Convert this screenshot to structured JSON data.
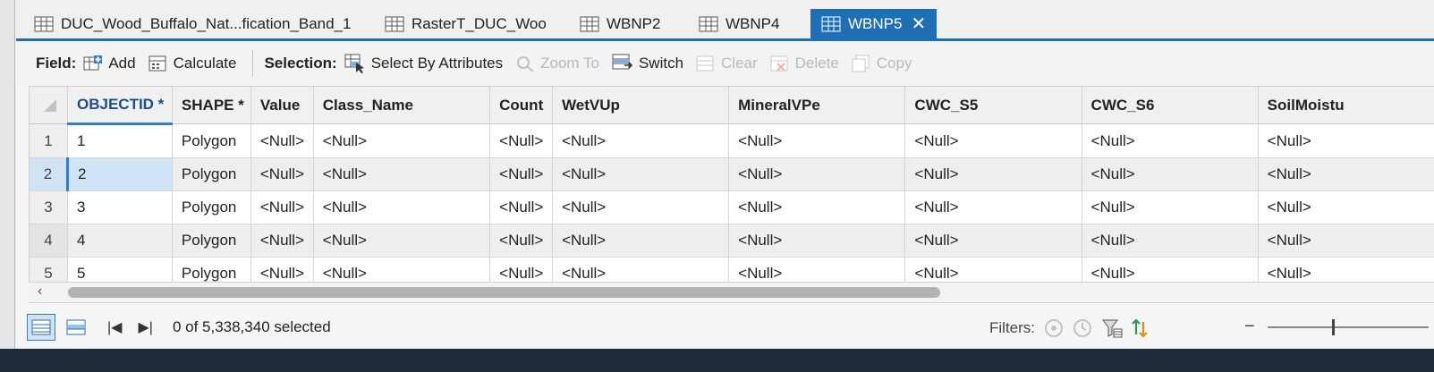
{
  "tabs": [
    {
      "label": "DUC_Wood_Buffalo_Nat...fication_Band_1",
      "active": false
    },
    {
      "label": "RasterT_DUC_Woo",
      "active": false
    },
    {
      "label": "WBNP2",
      "active": false
    },
    {
      "label": "WBNP4",
      "active": false
    },
    {
      "label": "WBNP5",
      "active": true
    }
  ],
  "toolbar": {
    "field_label": "Field:",
    "add": "Add",
    "calculate": "Calculate",
    "selection_label": "Selection:",
    "select_by_attributes": "Select By Attributes",
    "zoom_to": "Zoom To",
    "switch": "Switch",
    "clear": "Clear",
    "delete": "Delete",
    "copy": "Copy"
  },
  "table": {
    "columns": [
      "OBJECTID *",
      "SHAPE *",
      "Value",
      "Class_Name",
      "Count",
      "WetVUp",
      "MineralVPe",
      "CWC_S5",
      "CWC_S6",
      "SoilMoistu"
    ],
    "rows": [
      {
        "num": "1",
        "cells": [
          "1",
          "Polygon",
          "<Null>",
          "<Null>",
          "<Null>",
          "<Null>",
          "<Null>",
          "<Null>",
          "<Null>",
          "<Null>"
        ]
      },
      {
        "num": "2",
        "cells": [
          "2",
          "Polygon",
          "<Null>",
          "<Null>",
          "<Null>",
          "<Null>",
          "<Null>",
          "<Null>",
          "<Null>",
          "<Null>"
        ]
      },
      {
        "num": "3",
        "cells": [
          "3",
          "Polygon",
          "<Null>",
          "<Null>",
          "<Null>",
          "<Null>",
          "<Null>",
          "<Null>",
          "<Null>",
          "<Null>"
        ]
      },
      {
        "num": "4",
        "cells": [
          "4",
          "Polygon",
          "<Null>",
          "<Null>",
          "<Null>",
          "<Null>",
          "<Null>",
          "<Null>",
          "<Null>",
          "<Null>"
        ]
      },
      {
        "num": "5",
        "cells": [
          "5",
          "Polygon",
          "<Null>",
          "<Null>",
          "<Null>",
          "<Null>",
          "<Null>",
          "<Null>",
          "<Null>",
          "<Null>"
        ]
      }
    ]
  },
  "status": {
    "selected_text": "0 of 5,338,340 selected",
    "filters_label": "Filters:"
  },
  "colors": {
    "accent": "#1f6fb5",
    "selected_row": "#cfe5f7"
  }
}
